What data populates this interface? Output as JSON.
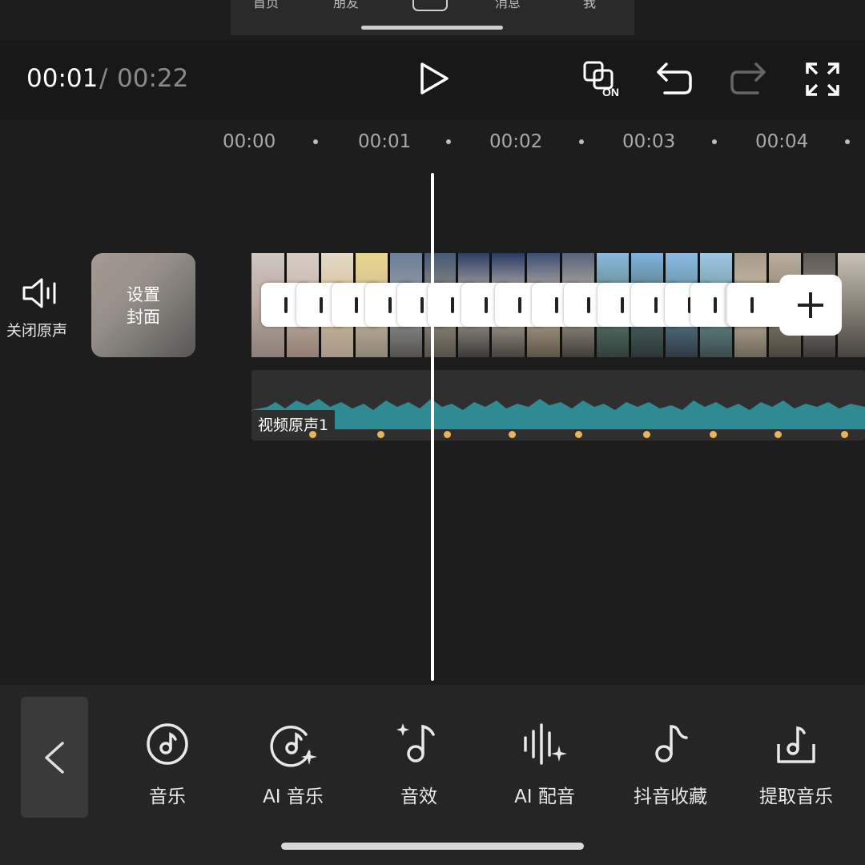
{
  "top_nav": {
    "items": [
      "首页",
      "朋友",
      "消息",
      "我"
    ]
  },
  "header": {
    "current_time": "00:01",
    "separator": "/",
    "total_time": "00:22",
    "buttons": [
      "play-icon",
      "original-sound-on-icon",
      "undo-icon",
      "redo-icon",
      "fullscreen-icon"
    ]
  },
  "ruler": {
    "ticks": [
      "00:00",
      "00:01",
      "00:02",
      "00:03",
      "00:04"
    ]
  },
  "track": {
    "mute_label": "关闭原声",
    "cover_label": "设置\n封面",
    "audio_label": "视频原声1"
  },
  "toolbar": {
    "items": [
      {
        "label": "音乐",
        "icon": "music-disc-icon"
      },
      {
        "label": "AI 音乐",
        "icon": "ai-music-icon"
      },
      {
        "label": "音效",
        "icon": "sound-effect-icon"
      },
      {
        "label": "AI 配音",
        "icon": "ai-dubbing-icon"
      },
      {
        "label": "抖音收藏",
        "icon": "douyin-favorites-icon"
      },
      {
        "label": "提取音乐",
        "icon": "extract-music-icon"
      }
    ]
  },
  "colors": {
    "background": "#1d1d1d",
    "waveform": "#2e8a93",
    "keyframe": "#e6b55d"
  }
}
